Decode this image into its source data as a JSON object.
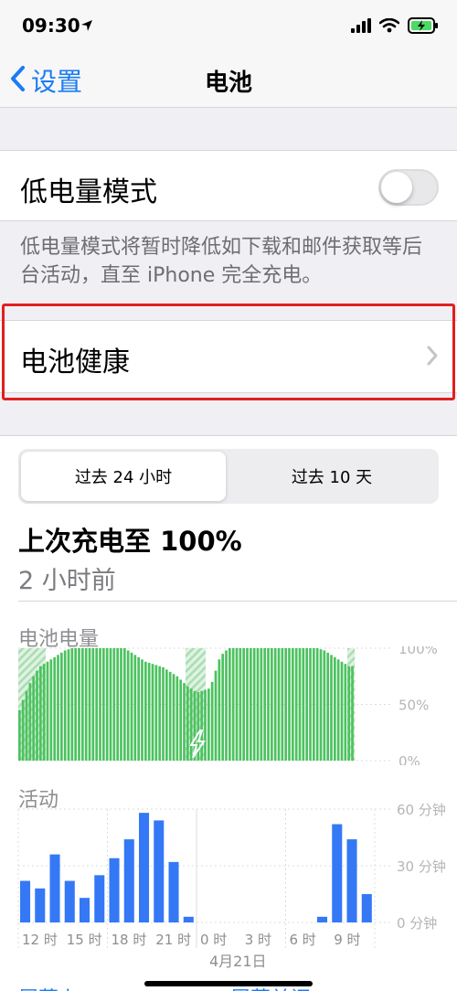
{
  "status_bar": {
    "time": "09:30",
    "icons": [
      "location-arrow-icon",
      "signal-icon",
      "wifi-icon",
      "battery-charging-icon"
    ]
  },
  "nav": {
    "back_label": "设置",
    "title": "电池"
  },
  "low_power": {
    "label": "低电量模式",
    "enabled": false,
    "footnote": "低电量模式将暂时降低如下载和邮件获取等后台活动，直至 iPhone 完全充电。"
  },
  "battery_health": {
    "label": "电池健康"
  },
  "usage": {
    "tabs": [
      {
        "label": "过去 24 小时",
        "selected": true
      },
      {
        "label": "过去 10 天",
        "selected": false
      }
    ],
    "last_charge": "上次充电至 100%",
    "ago": "2 小时前"
  },
  "colors": {
    "accent": "#1a7cf5",
    "battery_green": "#4cc25f",
    "activity_blue": "#3478f6",
    "highlight_red": "#e02020"
  },
  "chart_data": [
    {
      "type": "bar",
      "title": "电池电量",
      "y_ticks": [
        "100%",
        "50%",
        "0%"
      ],
      "ylim": [
        0,
        100
      ],
      "series": [
        {
          "name": "",
          "values": [
            45,
            54,
            62,
            69,
            75,
            80,
            84,
            86,
            88,
            90,
            92,
            94,
            96,
            98,
            99,
            100,
            100,
            100,
            100,
            100,
            100,
            100,
            100,
            100,
            100,
            100,
            100,
            100,
            100,
            100,
            100,
            98,
            96,
            94,
            92,
            90,
            88,
            87,
            86,
            85,
            84,
            83,
            81,
            79,
            77,
            75,
            72,
            69,
            66,
            64,
            62,
            61,
            62,
            63,
            64,
            70,
            80,
            90,
            95,
            98,
            100,
            100,
            100,
            100,
            100,
            100,
            100,
            100,
            100,
            100,
            100,
            100,
            100,
            100,
            100,
            100,
            100,
            100,
            100,
            100,
            100,
            100,
            100,
            100,
            100,
            100,
            99,
            98,
            96,
            94,
            92,
            90,
            88,
            86,
            84,
            84
          ]
        }
      ],
      "charging_markers": "shaded spans at start, before the dip, and at the end"
    },
    {
      "type": "bar",
      "title": "活动",
      "y_ticks": [
        "60 分钟",
        "30 分钟",
        "0 分钟"
      ],
      "ylim": [
        0,
        60
      ],
      "categories": [
        "12 时",
        "15 时",
        "18 时",
        "21 时",
        "0 时",
        "3 时",
        "6 时",
        "9 时"
      ],
      "date_label": "4月21日",
      "series": [
        {
          "name": "",
          "values": [
            22,
            18,
            36,
            22,
            13,
            25,
            34,
            44,
            58,
            54,
            32,
            3,
            0,
            0,
            0,
            0,
            0,
            0,
            0,
            0,
            3,
            52,
            44,
            15
          ]
        }
      ]
    }
  ],
  "bottom_partial": {
    "left": "屏幕上",
    "right": "屏幕关闭"
  }
}
